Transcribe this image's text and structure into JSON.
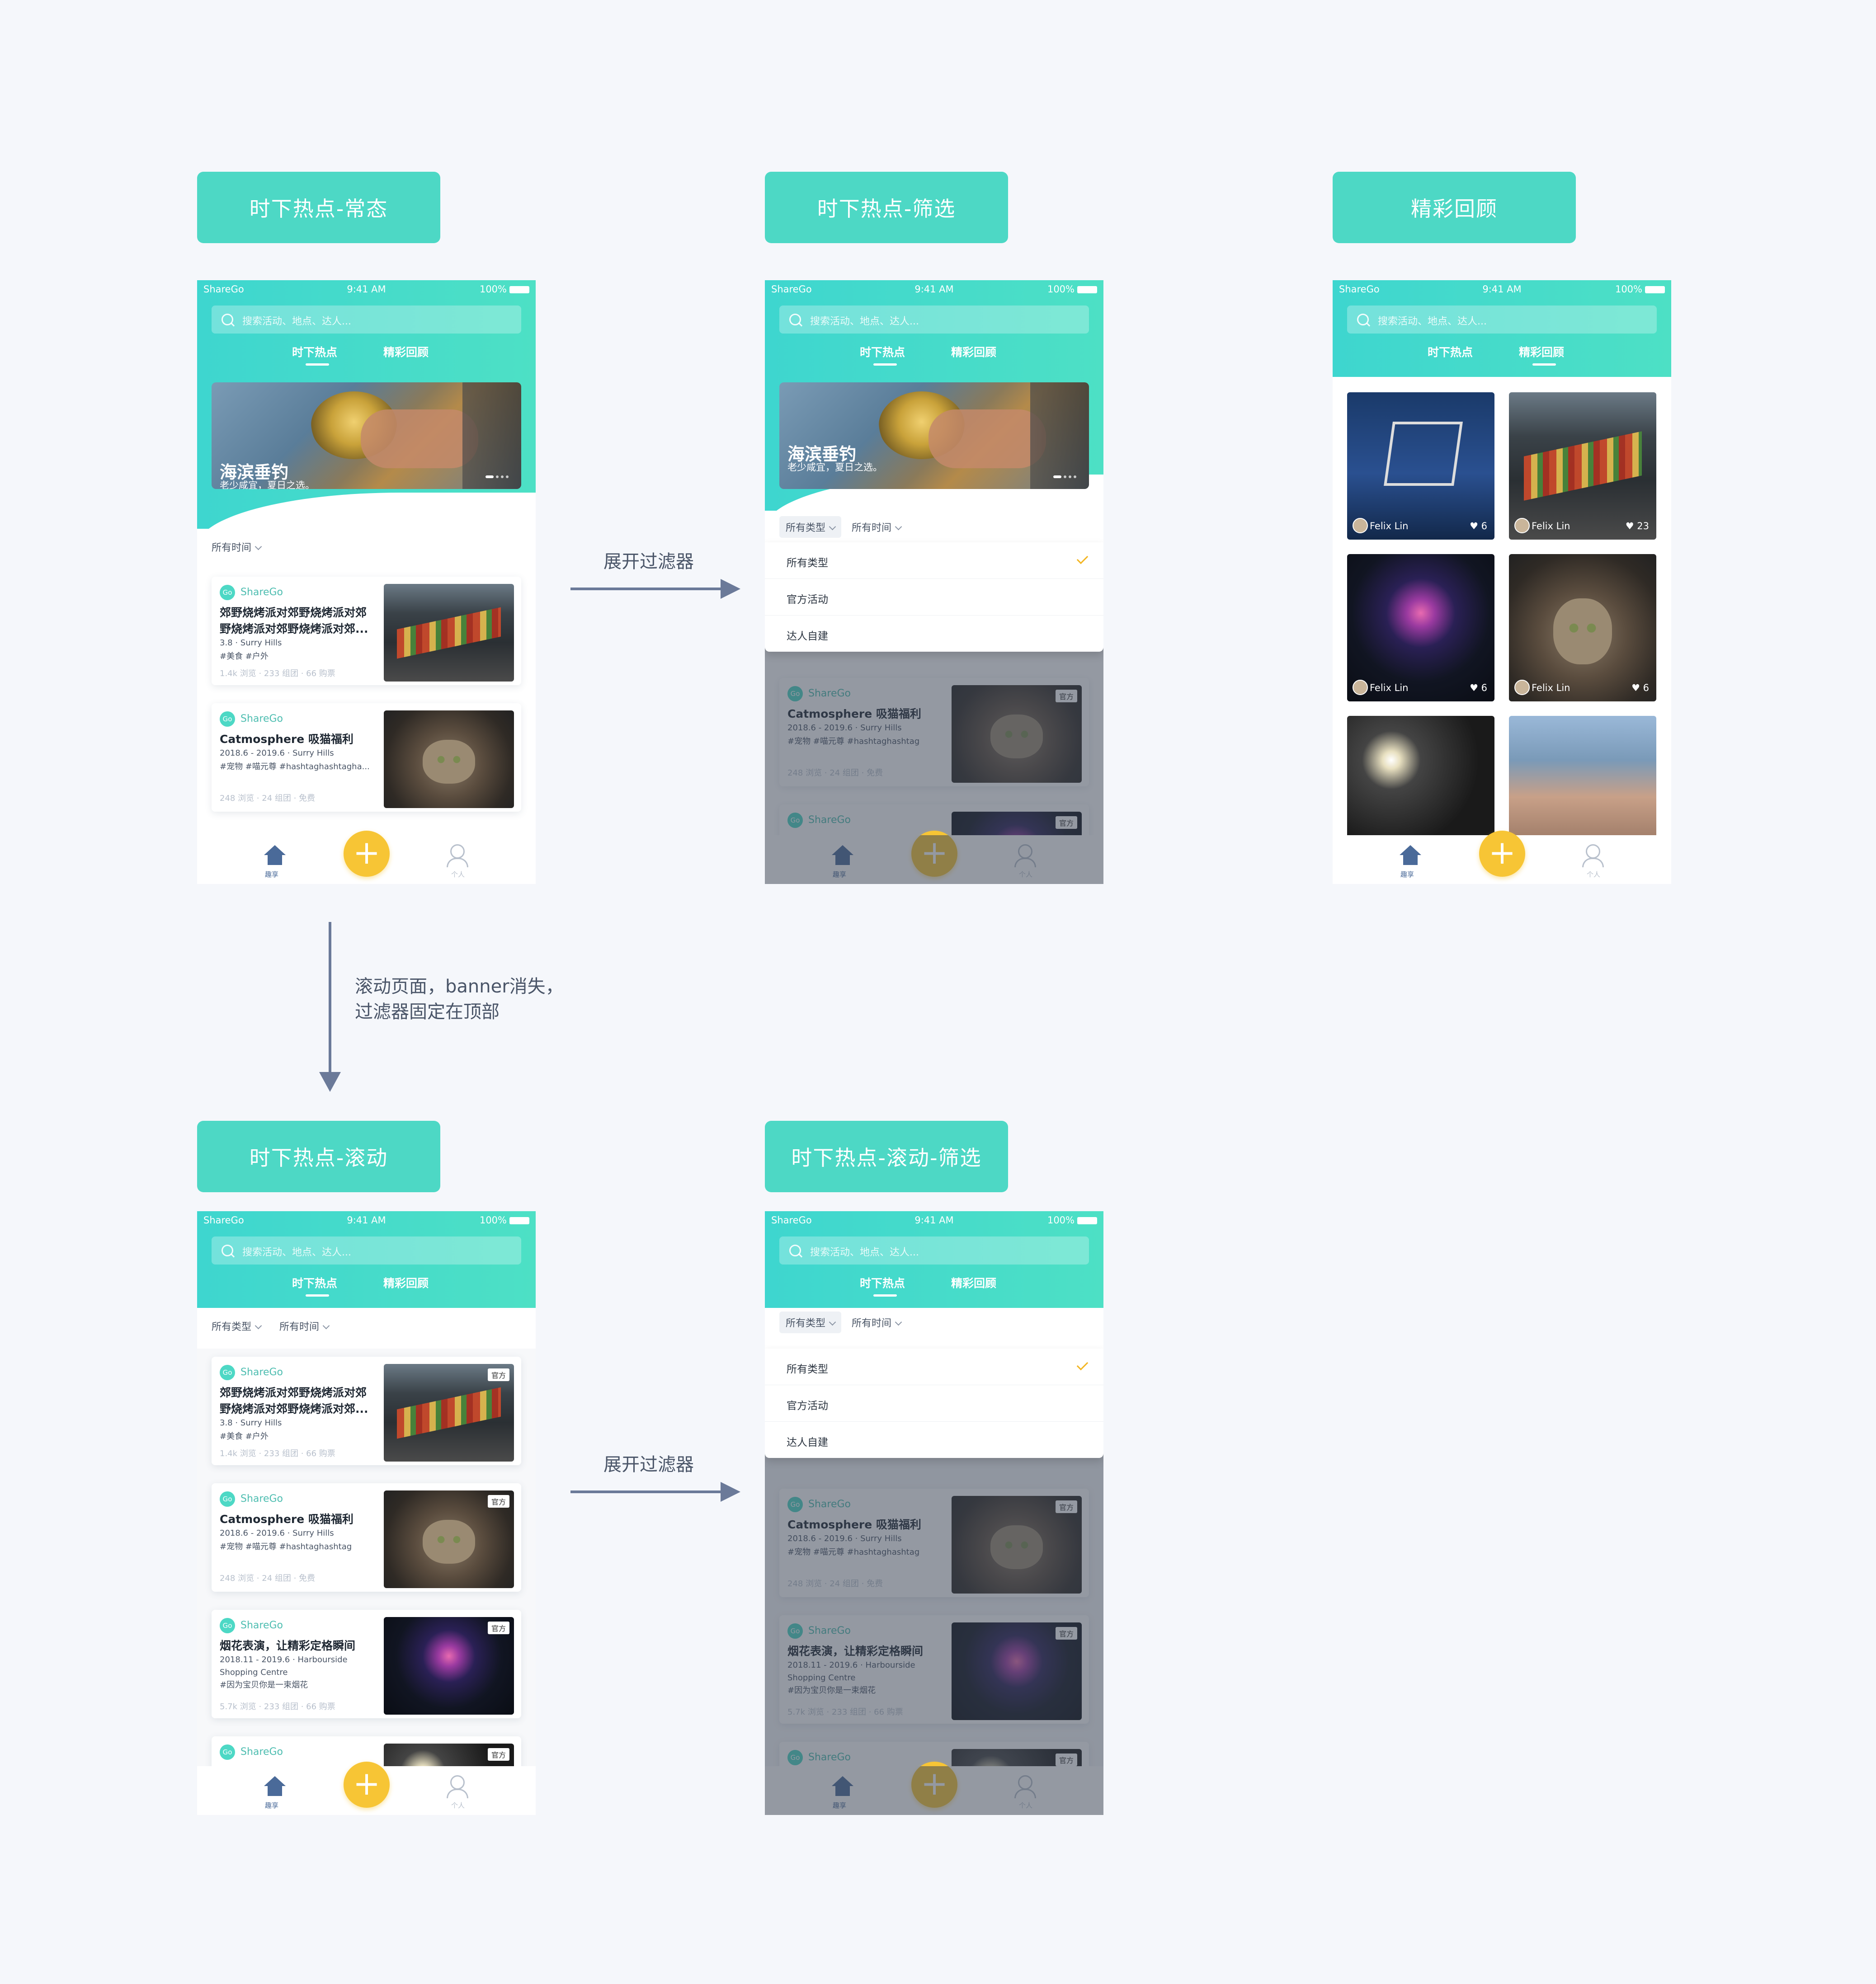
{
  "labels": {
    "s1": "时下热点-常态",
    "s2": "时下热点-筛选",
    "s3": "精彩回顾",
    "s4": "时下热点-滚动",
    "s5": "时下热点-滚动-筛选"
  },
  "annotations": {
    "expand_filter": "展开过滤器",
    "scroll_note_1": "滚动页面，banner消失，",
    "scroll_note_2": "过滤器固定在顶部"
  },
  "status": {
    "carrier": "ShareGo",
    "time": "9:41 AM",
    "battery": "100%"
  },
  "search": {
    "placeholder": "搜索活动、地点、达人..."
  },
  "tabs": {
    "hot": "时下热点",
    "review": "精彩回顾"
  },
  "banner": {
    "title": "海滨垂钓",
    "subtitle": "老少咸宜，夏日之选。"
  },
  "filters": {
    "type": "所有类型",
    "time": "所有时间"
  },
  "dropdown": {
    "options": [
      "所有类型",
      "官方活动",
      "达人自建"
    ]
  },
  "cards": [
    {
      "brand": "ShareGo",
      "title": "郊野烧烤派对郊野烧烤派对郊野烧烤派对郊野烧烤派对郊...",
      "date_place": "3.8 · Surry Hills",
      "tags": "#美食  #户外",
      "stats": "1.4k 浏览 · 233 组团 · 66 购票",
      "badge": "官方"
    },
    {
      "brand": "ShareGo",
      "title": "Catmosphere 吸猫福利",
      "date_place": "2018.6 - 2019.6 · Surry Hills",
      "tags": "#宠物  #喵元尊  #hashtaghashtagha...",
      "tags_alt": "#宠物  #喵元尊  #hashtaghashtag",
      "stats": "248 浏览 · 24 组团 · 免费",
      "badge": "官方"
    },
    {
      "brand": "ShareGo",
      "title": "烟花表演，让精彩定格瞬间",
      "date_place": "2018.11 - 2019.6 · Harbourside",
      "place2": "Shopping Centre",
      "tags": "#因为宝贝你是一束烟花",
      "stats": "5.7k 浏览 · 233 组团 · 66 购票",
      "badge": "官方"
    },
    {
      "brand": "ShareGo",
      "badge": "官方"
    }
  ],
  "gallery": [
    {
      "user": "Felix Lin",
      "likes": "6"
    },
    {
      "user": "Felix Lin",
      "likes": "23"
    },
    {
      "user": "Felix Lin",
      "likes": "6"
    },
    {
      "user": "Felix Lin",
      "likes": "6"
    }
  ],
  "nav": {
    "home": "趣享",
    "profile": "个人",
    "plus": "+"
  },
  "icons": {
    "search": "search-icon",
    "home": "home-icon",
    "plus": "plus-icon",
    "user": "user-icon",
    "heart": "heart-icon",
    "check": "check-icon",
    "chevron": "chevron-down-icon"
  },
  "colors": {
    "accent": "#4dd8c5",
    "fab": "#f7c535",
    "check": "#f3b623",
    "arrow": "#6b7a99"
  }
}
